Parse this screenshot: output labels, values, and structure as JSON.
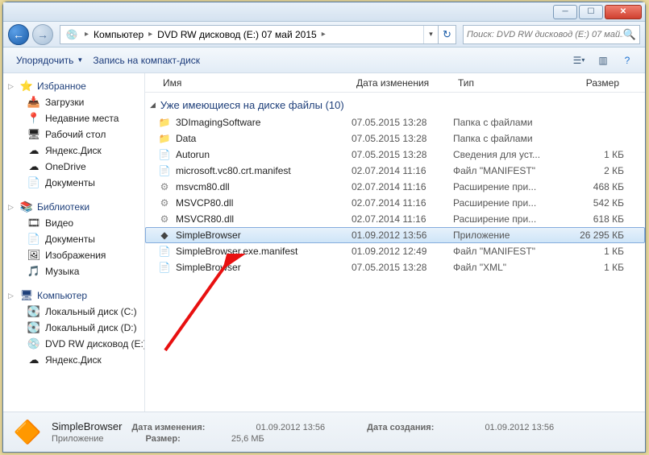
{
  "title_ghost": "",
  "breadcrumb": {
    "root": "Компьютер",
    "seg2": "DVD RW дисковод (E:) 07 май 2015"
  },
  "search": {
    "placeholder": "Поиск: DVD RW дисковод (E:) 07 май..."
  },
  "toolbar": {
    "organize": "Упорядочить",
    "burn": "Запись на компакт-диск"
  },
  "columns": {
    "name": "Имя",
    "modified": "Дата изменения",
    "type": "Тип",
    "size": "Размер"
  },
  "group_header": "Уже имеющиеся на диске файлы (10)",
  "sidebar": {
    "favorites": {
      "label": "Избранное",
      "items": [
        "Загрузки",
        "Недавние места",
        "Рабочий стол",
        "Яндекс.Диск",
        "OneDrive",
        "Документы"
      ]
    },
    "libraries": {
      "label": "Библиотеки",
      "items": [
        "Видео",
        "Документы",
        "Изображения",
        "Музыка"
      ]
    },
    "computer": {
      "label": "Компьютер",
      "items": [
        "Локальный диск (C:)",
        "Локальный диск (D:)",
        "DVD RW дисковод (E:)",
        "Яндекс.Диск"
      ]
    }
  },
  "files": [
    {
      "icon": "fld",
      "name": "3DImagingSoftware",
      "date": "07.05.2015 13:28",
      "type": "Папка с файлами",
      "size": ""
    },
    {
      "icon": "fld",
      "name": "Data",
      "date": "07.05.2015 13:28",
      "type": "Папка с файлами",
      "size": ""
    },
    {
      "icon": "txt",
      "name": "Autorun",
      "date": "07.05.2015 13:28",
      "type": "Сведения для уст...",
      "size": "1 КБ"
    },
    {
      "icon": "txt",
      "name": "microsoft.vc80.crt.manifest",
      "date": "02.07.2014 11:16",
      "type": "Файл \"MANIFEST\"",
      "size": "2 КБ"
    },
    {
      "icon": "dll",
      "name": "msvcm80.dll",
      "date": "02.07.2014 11:16",
      "type": "Расширение при...",
      "size": "468 КБ"
    },
    {
      "icon": "dll",
      "name": "MSVCP80.dll",
      "date": "02.07.2014 11:16",
      "type": "Расширение при...",
      "size": "542 КБ"
    },
    {
      "icon": "dll",
      "name": "MSVCR80.dll",
      "date": "02.07.2014 11:16",
      "type": "Расширение при...",
      "size": "618 КБ"
    },
    {
      "icon": "exe",
      "name": "SimpleBrowser",
      "date": "01.09.2012 13:56",
      "type": "Приложение",
      "size": "26 295 КБ",
      "selected": true
    },
    {
      "icon": "txt",
      "name": "SimpleBrowser.exe.manifest",
      "date": "01.09.2012 12:49",
      "type": "Файл \"MANIFEST\"",
      "size": "1 КБ"
    },
    {
      "icon": "txt",
      "name": "SimpleBrowser",
      "date": "07.05.2015 13:28",
      "type": "Файл \"XML\"",
      "size": "1 КБ"
    }
  ],
  "details": {
    "name": "SimpleBrowser",
    "sub": "Приложение",
    "mod_label": "Дата изменения:",
    "mod": "01.09.2012 13:56",
    "size_label": "Размер:",
    "size": "25,6 МБ",
    "created_label": "Дата создания:",
    "created": "01.09.2012 13:56"
  }
}
